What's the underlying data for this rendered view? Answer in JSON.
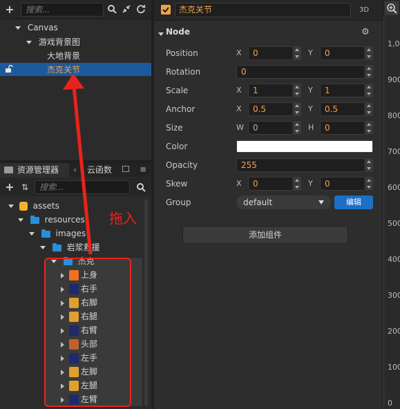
{
  "hierarchy": {
    "search_placeholder": "搜索...",
    "nodes": [
      {
        "label": "Canvas",
        "level": 0
      },
      {
        "label": "游戏背景图",
        "level": 1
      },
      {
        "label": "大地背景",
        "level": 2
      },
      {
        "label": "杰克关节",
        "level": 2,
        "selected": true
      }
    ]
  },
  "assets": {
    "tab_label": "资源管理器",
    "tab2_label": "云函数",
    "search_placeholder": "搜索...",
    "tree": [
      {
        "label": "assets",
        "level": 0
      },
      {
        "label": "resources",
        "level": 1
      },
      {
        "label": "images",
        "level": 2
      },
      {
        "label": "岩浆救援",
        "level": 3
      },
      {
        "label": "杰克",
        "level": 4
      }
    ],
    "sprites": [
      "上身",
      "右手",
      "右脚",
      "右腿",
      "右臂",
      "头部",
      "左手",
      "左脚",
      "左腿",
      "左臂"
    ],
    "annotation": "拖入"
  },
  "inspector": {
    "node_name": "杰克关节",
    "mode_3d": "3D",
    "section_title": "Node",
    "properties": {
      "position": {
        "label": "Position",
        "x_axis": "X",
        "x": "0",
        "y_axis": "Y",
        "y": "0"
      },
      "rotation": {
        "label": "Rotation",
        "value": "0"
      },
      "scale": {
        "label": "Scale",
        "x_axis": "X",
        "x": "1",
        "y_axis": "Y",
        "y": "1"
      },
      "anchor": {
        "label": "Anchor",
        "x_axis": "X",
        "x": "0.5",
        "y_axis": "Y",
        "y": "0.5"
      },
      "size": {
        "label": "Size",
        "w_axis": "W",
        "w": "0",
        "h_axis": "H",
        "h": "0"
      },
      "color": {
        "label": "Color",
        "value": "#ffffff"
      },
      "opacity": {
        "label": "Opacity",
        "value": "255"
      },
      "skew": {
        "label": "Skew",
        "x_axis": "X",
        "x": "0",
        "y_axis": "Y",
        "y": "0"
      },
      "group": {
        "label": "Group",
        "value": "default",
        "edit": "编辑"
      }
    },
    "add_component": "添加组件"
  },
  "ruler": {
    "labels": [
      "1,00",
      "900",
      "800",
      "700",
      "600",
      "500",
      "400",
      "300",
      "200",
      "100",
      "0"
    ]
  },
  "colors": {
    "accent": "#1c5a9e",
    "selected_text": "#f0a24b",
    "annotation_red": "#e8231b"
  }
}
